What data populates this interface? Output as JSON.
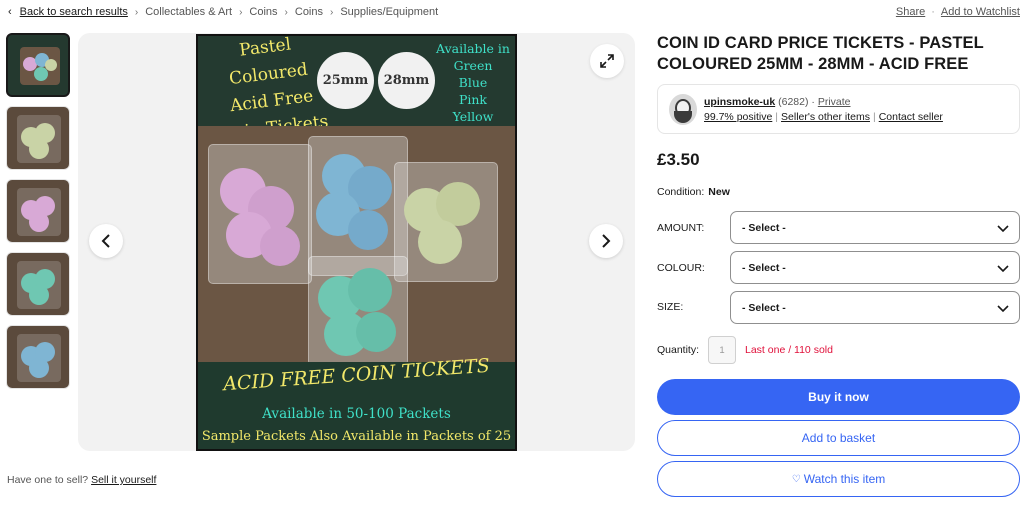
{
  "breadcrumb": {
    "back_label": "Back to search results",
    "items": [
      "Collectables & Art",
      "Coins",
      "Coins",
      "Supplies/Equipment"
    ]
  },
  "actions": {
    "share": "Share",
    "watchlist": "Add to Watchlist"
  },
  "product_image": {
    "title_lines": [
      "Pastel Coloured",
      "Acid Free",
      "Coin Tickets"
    ],
    "sizes": [
      "25mm",
      "28mm"
    ],
    "availability": [
      "Available in",
      "Green",
      "Blue",
      "Pink",
      "Yellow"
    ],
    "banner": "ACID FREE COIN TICKETS",
    "line1": "Available in 50-100 Packets",
    "line2": "Sample Packets Also Available in Packets of 25"
  },
  "sell_prompt": {
    "text": "Have one to sell?",
    "link": "Sell it yourself"
  },
  "listing": {
    "title": "COIN ID CARD PRICE TICKETS - PASTEL COLOURED 25MM - 28MM - ACID FREE",
    "seller": {
      "name": "upinsmoke-uk",
      "feedback_count": "(6282)",
      "type": "Private",
      "positive": "99.7% positive",
      "other_items": "Seller's other items",
      "contact": "Contact seller"
    },
    "price": "£3.50",
    "condition_label": "Condition:",
    "condition_value": "New",
    "options": [
      {
        "label": "AMOUNT:",
        "value": "- Select -"
      },
      {
        "label": "COLOUR:",
        "value": "- Select -"
      },
      {
        "label": "SIZE:",
        "value": "- Select -"
      }
    ],
    "quantity_label": "Quantity:",
    "quantity_value": "1",
    "stock_note": "Last one / 110 sold",
    "buy_now": "Buy it now",
    "add_basket": "Add to basket",
    "watch": "Watch this item"
  },
  "colors": {
    "accent": "#3665f3",
    "alert": "#e0103a",
    "disc_pink": "#d8a9d6",
    "disc_blue": "#7fb5d3",
    "disc_green": "#c9d3a6",
    "disc_teal": "#6fc7b2"
  }
}
